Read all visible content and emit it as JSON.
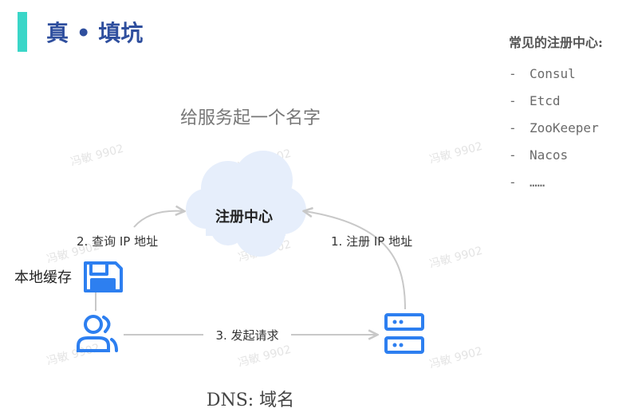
{
  "header": {
    "title": "真 • 填坑"
  },
  "sidebar": {
    "title": "常见的注册中心:",
    "items": [
      {
        "dash": "-",
        "label": "Consul"
      },
      {
        "dash": "-",
        "label": "Etcd"
      },
      {
        "dash": "-",
        "label": "ZooKeeper"
      },
      {
        "dash": "-",
        "label": "Nacos"
      },
      {
        "dash": "-",
        "label": "……"
      }
    ]
  },
  "diagram": {
    "heading": "给服务起一个名字",
    "cloud_label": "注册中心",
    "step_query": "2. 查询 IP 地址",
    "step_register": "1. 注册 IP 地址",
    "step_request": "3. 发起请求",
    "local_cache_label": "本地缓存",
    "caption": "DNS: 域名",
    "watermark": "冯敏 9902"
  },
  "colors": {
    "accent": "#3ad6c8",
    "title": "#2f4f9e",
    "icon_blue": "#2d7ff0",
    "arrow_gray": "#c8c8c8",
    "cloud_fill": "#e6eefb"
  }
}
